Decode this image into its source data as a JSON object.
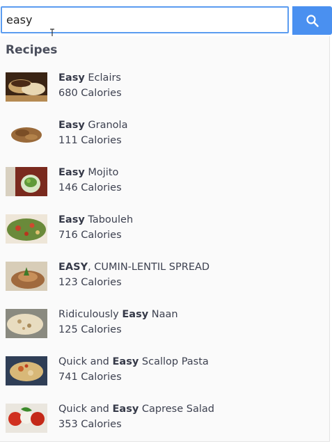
{
  "search": {
    "value": "easy",
    "button_icon": "search-icon",
    "accent_color": "#4a90f0",
    "border_color": "#5b9cf0"
  },
  "results": {
    "heading": "Recipes",
    "items": [
      {
        "pre": "",
        "match": "Easy",
        "post": " Eclairs",
        "calories": "680 Calories",
        "thumb": "eclairs-photo"
      },
      {
        "pre": "",
        "match": "Easy",
        "post": " Granola",
        "calories": "111 Calories",
        "thumb": "granola-photo"
      },
      {
        "pre": "",
        "match": "Easy",
        "post": " Mojito",
        "calories": "146 Calories",
        "thumb": "mojito-photo"
      },
      {
        "pre": "",
        "match": "Easy",
        "post": " Tabouleh",
        "calories": "716 Calories",
        "thumb": "tabouleh-photo"
      },
      {
        "pre": "",
        "match": "EASY",
        "post": ", CUMIN-LENTIL SPREAD",
        "calories": "123 Calories",
        "thumb": "lentil-spread-photo"
      },
      {
        "pre": "Ridiculously ",
        "match": "Easy",
        "post": " Naan",
        "calories": "125 Calories",
        "thumb": "naan-photo"
      },
      {
        "pre": "Quick and ",
        "match": "Easy",
        "post": " Scallop Pasta",
        "calories": "741 Calories",
        "thumb": "scallop-pasta-photo"
      },
      {
        "pre": "Quick and ",
        "match": "Easy",
        "post": " Caprese Salad",
        "calories": "353 Calories",
        "thumb": "caprese-salad-photo"
      }
    ]
  }
}
